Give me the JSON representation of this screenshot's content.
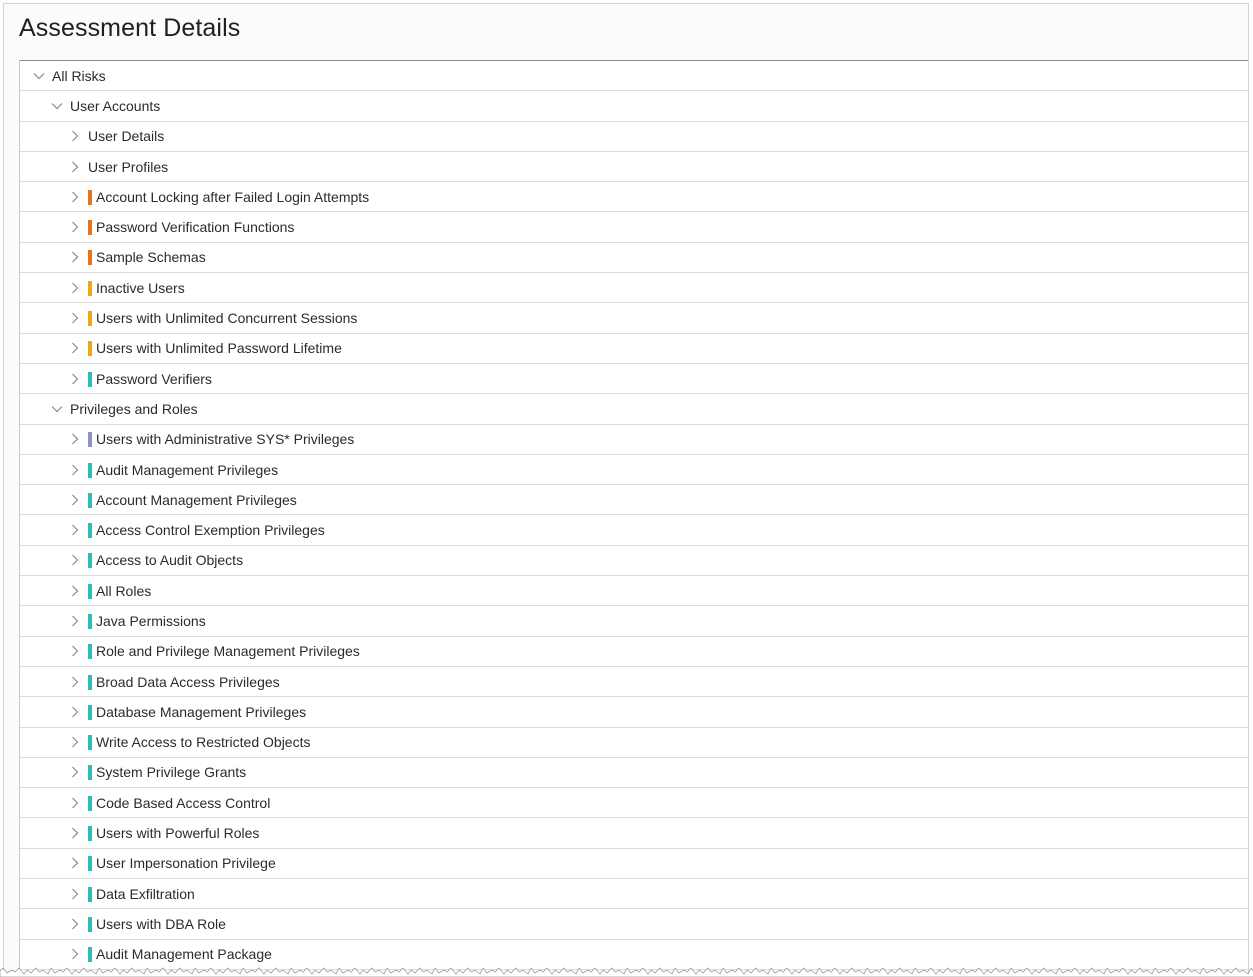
{
  "page": {
    "title": "Assessment Details"
  },
  "colors": {
    "high": "#e8731e",
    "medium": "#f2a516",
    "advisory": "#8e93c4",
    "low": "#2bbfb3"
  },
  "tree": {
    "root": {
      "label": "All Risks",
      "expanded": true,
      "icon": "chevron-down-icon"
    },
    "groups": [
      {
        "label": "User Accounts",
        "expanded": true,
        "icon": "chevron-down-icon",
        "items": [
          {
            "label": "User Details",
            "severity": "none"
          },
          {
            "label": "User Profiles",
            "severity": "none"
          },
          {
            "label": "Account Locking after Failed Login Attempts",
            "severity": "high"
          },
          {
            "label": "Password Verification Functions",
            "severity": "high"
          },
          {
            "label": "Sample Schemas",
            "severity": "high"
          },
          {
            "label": "Inactive Users",
            "severity": "medium"
          },
          {
            "label": "Users with Unlimited Concurrent Sessions",
            "severity": "medium"
          },
          {
            "label": "Users with Unlimited Password Lifetime",
            "severity": "medium"
          },
          {
            "label": "Password Verifiers",
            "severity": "low"
          }
        ]
      },
      {
        "label": "Privileges and Roles",
        "expanded": true,
        "icon": "chevron-down-icon",
        "items": [
          {
            "label": "Users with Administrative SYS* Privileges",
            "severity": "advisory"
          },
          {
            "label": "Audit Management Privileges",
            "severity": "low"
          },
          {
            "label": "Account Management Privileges",
            "severity": "low"
          },
          {
            "label": "Access Control Exemption Privileges",
            "severity": "low"
          },
          {
            "label": "Access to Audit Objects",
            "severity": "low"
          },
          {
            "label": "All Roles",
            "severity": "low"
          },
          {
            "label": "Java Permissions",
            "severity": "low"
          },
          {
            "label": "Role and Privilege Management Privileges",
            "severity": "low"
          },
          {
            "label": "Broad Data Access Privileges",
            "severity": "low"
          },
          {
            "label": "Database Management Privileges",
            "severity": "low"
          },
          {
            "label": "Write Access to Restricted Objects",
            "severity": "low"
          },
          {
            "label": "System Privilege Grants",
            "severity": "low"
          },
          {
            "label": "Code Based Access Control",
            "severity": "low"
          },
          {
            "label": "Users with Powerful Roles",
            "severity": "low"
          },
          {
            "label": "User Impersonation Privilege",
            "severity": "low"
          },
          {
            "label": "Data Exfiltration",
            "severity": "low"
          },
          {
            "label": "Users with DBA Role",
            "severity": "low"
          },
          {
            "label": "Audit Management Package",
            "severity": "low"
          }
        ]
      }
    ]
  }
}
